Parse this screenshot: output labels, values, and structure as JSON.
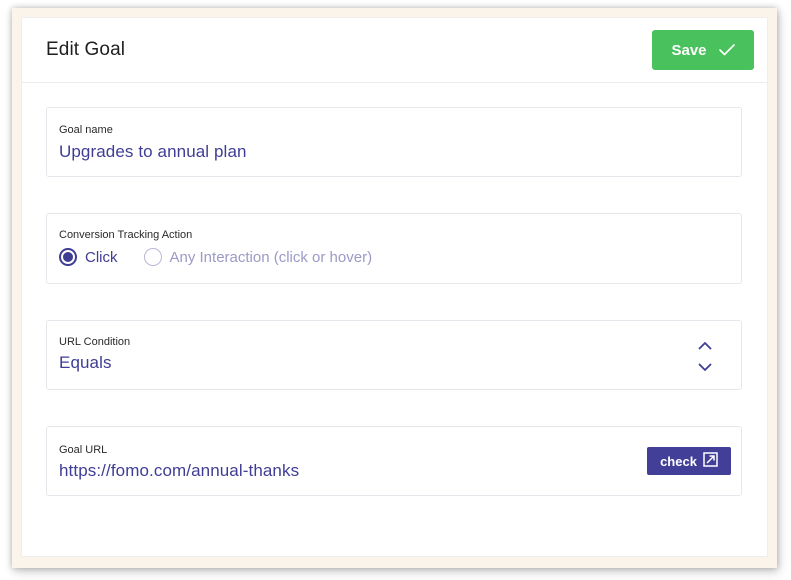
{
  "header": {
    "title": "Edit Goal",
    "save_label": "Save"
  },
  "goal_name": {
    "label": "Goal name",
    "value": "Upgrades to annual plan"
  },
  "conversion": {
    "label": "Conversion Tracking Action",
    "options": [
      {
        "label": "Click",
        "selected": true
      },
      {
        "label": "Any Interaction (click or hover)",
        "selected": false
      }
    ]
  },
  "url_condition": {
    "label": "URL Condition",
    "value": "Equals"
  },
  "goal_url": {
    "label": "Goal URL",
    "value": "https://fomo.com/annual-thanks",
    "check_label": "check"
  },
  "icons": {
    "save": "checkmark-icon",
    "stepper_up": "chevron-up-icon",
    "stepper_down": "chevron-down-icon",
    "check": "external-link-icon"
  },
  "colors": {
    "save_button": "#49c15c",
    "accent": "#3f3d94",
    "check_button": "#423f98",
    "inactive_text": "#9b9ac6"
  }
}
